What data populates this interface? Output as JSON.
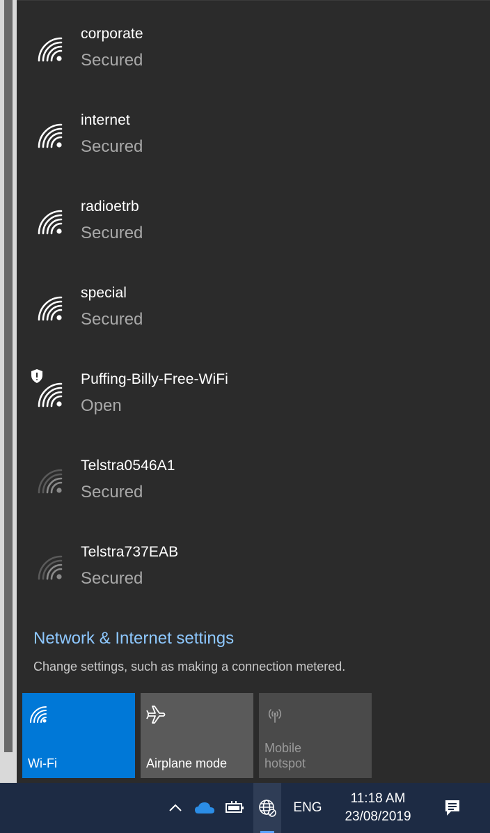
{
  "networks": [
    {
      "name": "corporate",
      "status": "Secured",
      "dim": false,
      "shield": false
    },
    {
      "name": "internet",
      "status": "Secured",
      "dim": false,
      "shield": false
    },
    {
      "name": "radioetrb",
      "status": "Secured",
      "dim": false,
      "shield": false
    },
    {
      "name": "special",
      "status": "Secured",
      "dim": false,
      "shield": false
    },
    {
      "name": "Puffing-Billy-Free-WiFi",
      "status": "Open",
      "dim": false,
      "shield": true
    },
    {
      "name": "Telstra0546A1",
      "status": "Secured",
      "dim": true,
      "shield": false
    },
    {
      "name": "Telstra737EAB",
      "status": "Secured",
      "dim": true,
      "shield": false
    }
  ],
  "settings": {
    "link": "Network & Internet settings",
    "description": "Change settings, such as making a connection metered."
  },
  "tiles": {
    "wifi": "Wi-Fi",
    "airplane": "Airplane mode",
    "hotspot": "Mobile hotspot"
  },
  "taskbar": {
    "language": "ENG",
    "time": "11:18 AM",
    "date": "23/08/2019"
  },
  "colors": {
    "accent": "#0078d7",
    "flyout_bg": "#2b2b2b",
    "link": "#8ec8ff",
    "taskbar": "#1d2b44"
  }
}
